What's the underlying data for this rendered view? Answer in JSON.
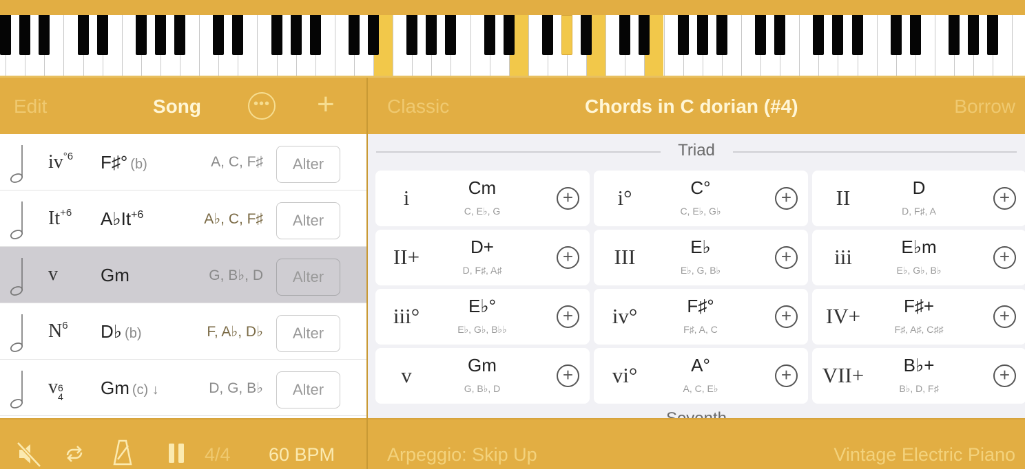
{
  "colors": {
    "accent": "#e2ae43",
    "highlight_key": "#f2c84a",
    "selected_row": "#cfcdd2"
  },
  "piano": {
    "highlighted_white_keys": [
      20,
      27,
      31,
      34
    ],
    "highlighted_black_keys": [
      29
    ]
  },
  "song_panel": {
    "edit_label": "Edit",
    "title": "Song",
    "more_icon": "ellipsis-circle-icon",
    "add_icon": "plus-icon",
    "rows": [
      {
        "duration_icon": "half-note-icon",
        "roman": "iv",
        "roman_sup": "°6",
        "chord": "F♯°",
        "chord_sup": "",
        "inversion": "(b)",
        "notes": "A, C, F♯",
        "altered_notes": false,
        "alter_label": "Alter",
        "selected": false
      },
      {
        "duration_icon": "half-note-icon",
        "roman": "It",
        "roman_sup": "+6",
        "chord": "A♭It",
        "chord_sup": "+6",
        "inversion": "",
        "notes": "A♭, C, F♯",
        "altered_notes": true,
        "alter_label": "Alter",
        "selected": false
      },
      {
        "duration_icon": "half-note-icon",
        "roman": "v",
        "roman_sup": "",
        "chord": "Gm",
        "chord_sup": "",
        "inversion": "",
        "notes": "G, B♭, D",
        "altered_notes": false,
        "alter_label": "Alter",
        "selected": true
      },
      {
        "duration_icon": "half-note-icon",
        "roman": "N",
        "roman_sup": "6",
        "chord": "D♭",
        "chord_sup": "",
        "inversion": "(b)",
        "notes": "F, A♭, D♭",
        "altered_notes": true,
        "alter_label": "Alter",
        "selected": false
      },
      {
        "duration_icon": "half-note-icon",
        "roman": "v",
        "roman_sup": "6/4",
        "chord": "Gm",
        "chord_sup": "",
        "inversion": "(c) ↓",
        "notes": "D, G, B♭",
        "altered_notes": false,
        "alter_label": "Alter",
        "selected": false
      }
    ],
    "footer": {
      "mute_icon": "speaker-muted-icon",
      "loop_icon": "loop-icon",
      "metronome_icon": "metronome-icon",
      "pause_icon": "pause-icon",
      "time_signature": "4/4",
      "tempo": "60 BPM"
    }
  },
  "chords_panel": {
    "left_label": "Classic",
    "title": "Chords in C dorian (#4)",
    "right_label": "Borrow",
    "sections": [
      {
        "label": "Triad",
        "chords": [
          {
            "roman": "i",
            "name": "Cm",
            "notes": "C, E♭, G"
          },
          {
            "roman": "i°",
            "name": "C°",
            "notes": "C, E♭, G♭"
          },
          {
            "roman": "II",
            "name": "D",
            "notes": "D, F♯, A"
          },
          {
            "roman": "II+",
            "name": "D+",
            "notes": "D, F♯, A♯"
          },
          {
            "roman": "III",
            "name": "E♭",
            "notes": "E♭, G, B♭"
          },
          {
            "roman": "iii",
            "name": "E♭m",
            "notes": "E♭, G♭, B♭"
          },
          {
            "roman": "iii°",
            "name": "E♭°",
            "notes": "E♭, G♭, B♭♭"
          },
          {
            "roman": "iv°",
            "name": "F♯°",
            "notes": "F♯, A, C"
          },
          {
            "roman": "IV+",
            "name": "F♯+",
            "notes": "F♯, A♯, C♯♯"
          },
          {
            "roman": "v",
            "name": "Gm",
            "notes": "G, B♭, D"
          },
          {
            "roman": "vi°",
            "name": "A°",
            "notes": "A, C, E♭"
          },
          {
            "roman": "VII+",
            "name": "B♭+",
            "notes": "B♭, D, F♯"
          }
        ]
      },
      {
        "label": "Seventh",
        "chords": []
      }
    ],
    "add_icon": "plus-circle-icon",
    "footer": {
      "arpeggio": "Arpeggio: Skip Up",
      "instrument": "Vintage Electric Piano"
    }
  }
}
